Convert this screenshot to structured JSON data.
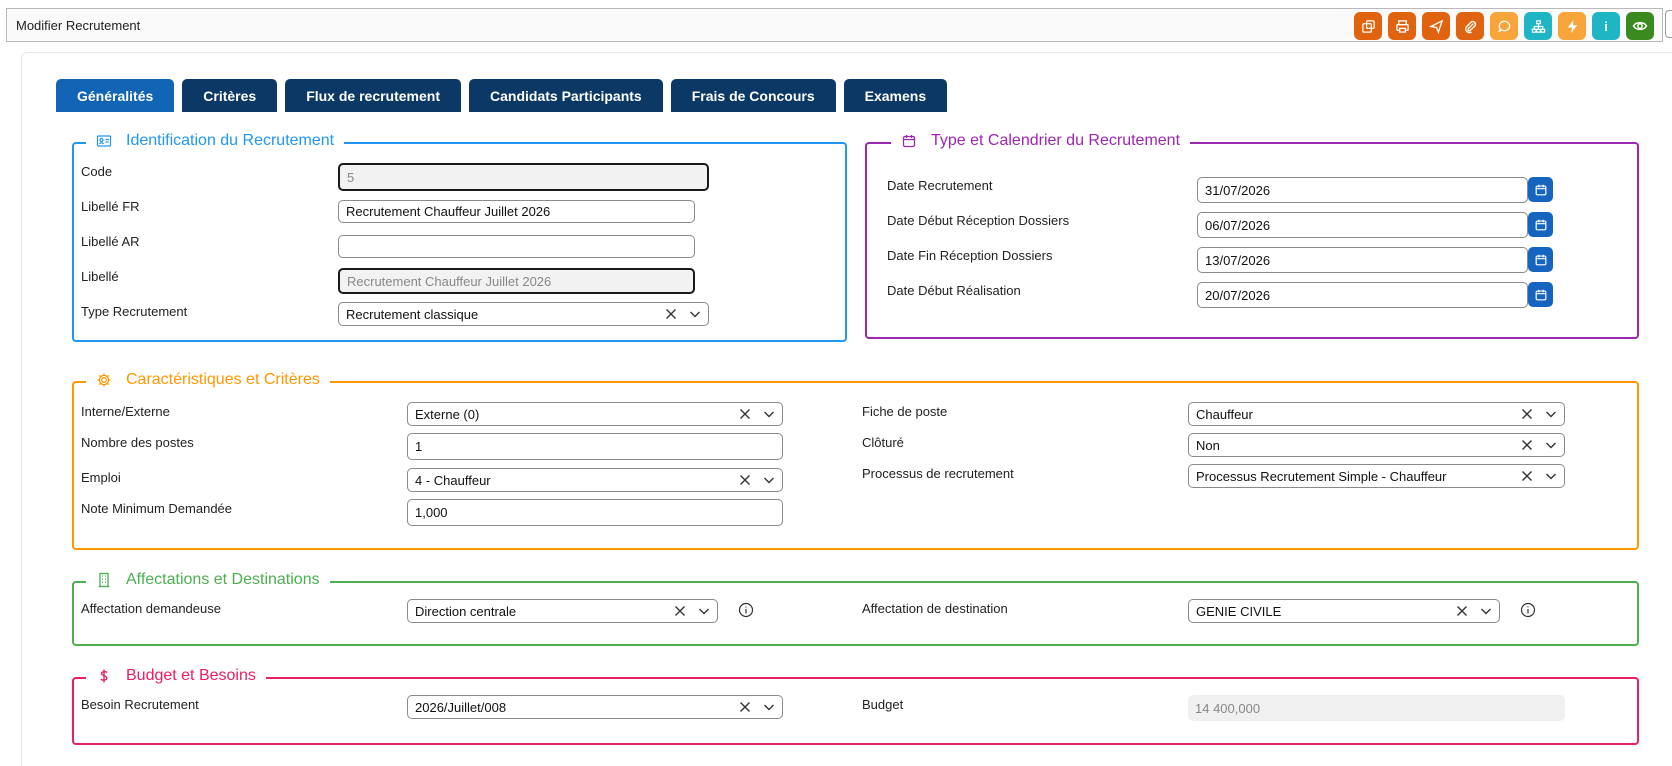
{
  "window": {
    "title": "Modifier Recrutement"
  },
  "toolbar": {
    "buttons": [
      {
        "name": "orders-icon",
        "color": "#e0640f"
      },
      {
        "name": "print-icon",
        "color": "#e0640f"
      },
      {
        "name": "send-icon",
        "color": "#e0640f"
      },
      {
        "name": "attach-icon",
        "color": "#e0640f"
      },
      {
        "name": "comment-icon",
        "color": "#f7a53b"
      },
      {
        "name": "hierarchy-icon",
        "color": "#1fb5c4"
      },
      {
        "name": "bolt-icon",
        "color": "#f7a53b"
      },
      {
        "name": "info-icon",
        "color": "#1fb5c4"
      },
      {
        "name": "eye-icon",
        "color": "#3a8a1f"
      }
    ],
    "info_glyph": "i"
  },
  "tabs": [
    {
      "label": "Généralités",
      "active": true
    },
    {
      "label": "Critères"
    },
    {
      "label": "Flux de recrutement"
    },
    {
      "label": "Candidats Participants"
    },
    {
      "label": "Frais de Concours"
    },
    {
      "label": "Examens"
    }
  ],
  "identification": {
    "title": "Identification du Recrutement",
    "color": "#2196f3",
    "code_label": "Code",
    "code_value": "5",
    "libelle_fr_label": "Libellé FR",
    "libelle_fr_value": "Recrutement Chauffeur Juillet 2026",
    "libelle_ar_label": "Libellé AR",
    "libelle_ar_value": "",
    "libelle_label": "Libellé",
    "libelle_value": "Recrutement Chauffeur Juillet 2026",
    "type_label": "Type Recrutement",
    "type_value": "Recrutement classique"
  },
  "calendar": {
    "title": "Type et Calendrier du Recrutement",
    "color": "#9c27b0",
    "date_recrutement_label": "Date Recrutement",
    "date_recrutement_value": "31/07/2026",
    "date_debut_reception_label": "Date Début Réception Dossiers",
    "date_debut_reception_value": "06/07/2026",
    "date_fin_reception_label": "Date Fin Réception Dossiers",
    "date_fin_reception_value": "13/07/2026",
    "date_debut_realisation_label": "Date Début Réalisation",
    "date_debut_realisation_value": "20/07/2026"
  },
  "criteria": {
    "title": "Caractéristiques et Critères",
    "color": "#ff9800",
    "interne_label": "Interne/Externe",
    "interne_value": "Externe (0)",
    "nombre_label": "Nombre des postes",
    "nombre_value": "1",
    "emploi_label": "Emploi",
    "emploi_value": "4 - Chauffeur",
    "note_label": "Note Minimum Demandée",
    "note_value": "1,000",
    "fiche_label": "Fiche de poste",
    "fiche_value": "Chauffeur",
    "cloture_label": "Clôturé",
    "cloture_value": "Non",
    "processus_label": "Processus de recrutement",
    "processus_value": "Processus Recrutement Simple - Chauffeur"
  },
  "affectations": {
    "title": "Affectations et Destinations",
    "color": "#4caf50",
    "demandeuse_label": "Affectation demandeuse",
    "demandeuse_value": "Direction centrale",
    "destination_label": "Affectation de destination",
    "destination_value": "GENIE CIVILE"
  },
  "budget": {
    "title": "Budget et Besoins",
    "color": "#e91e63",
    "besoin_label": "Besoin Recrutement",
    "besoin_value": "2026/Juillet/008",
    "budget_label": "Budget",
    "budget_value": "14 400,000"
  }
}
